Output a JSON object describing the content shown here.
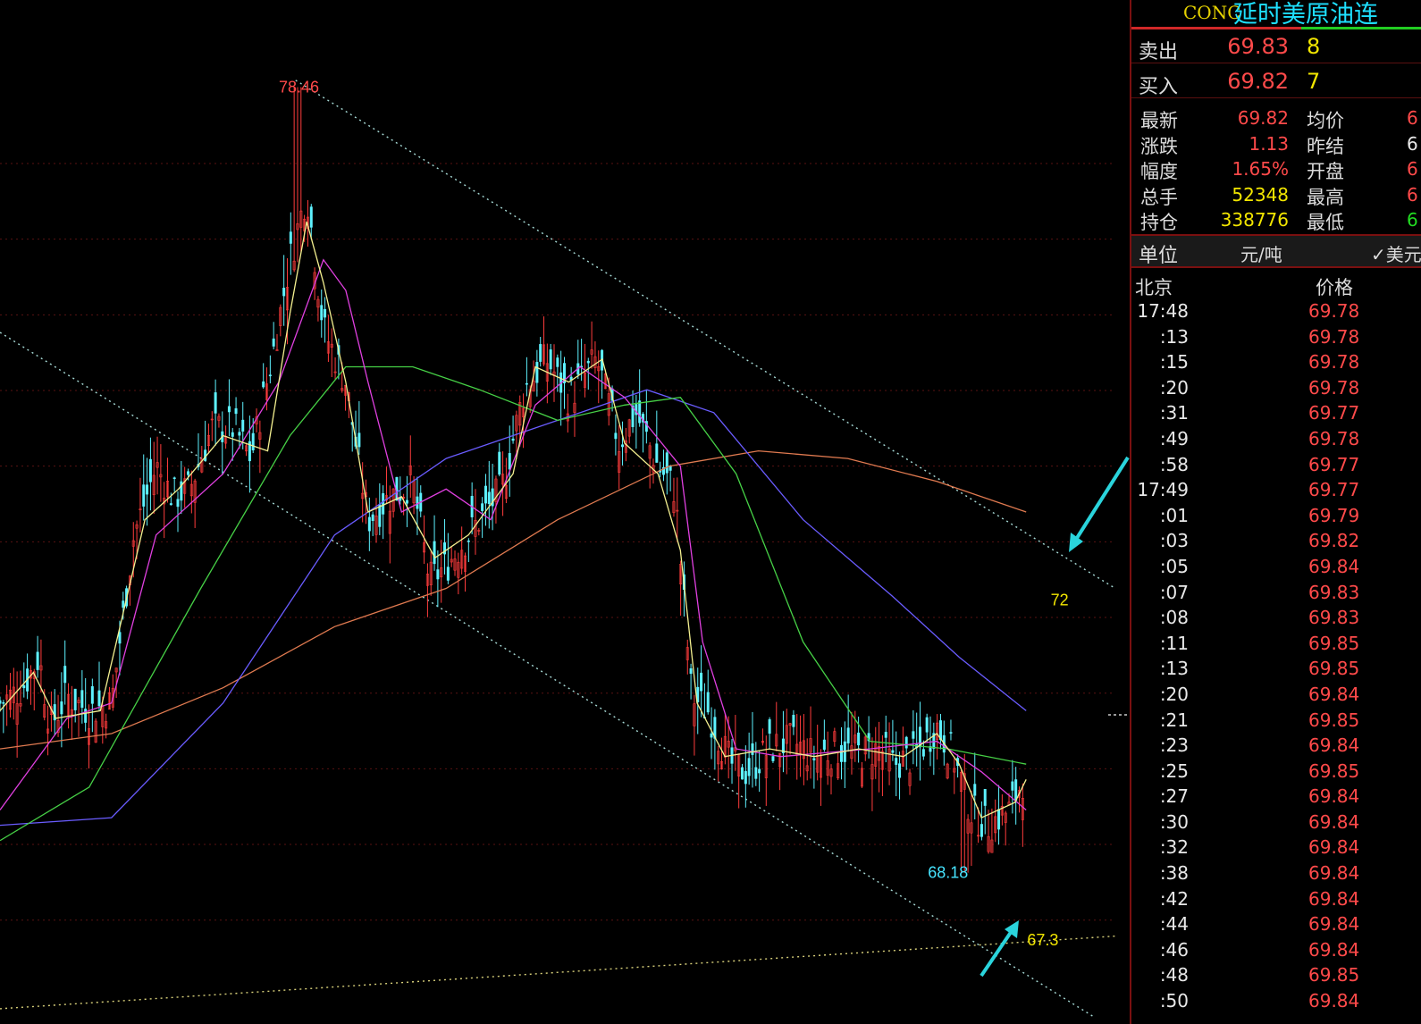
{
  "chart_data": {
    "type": "candlestick",
    "ylim": [
      66.2,
      79.6
    ],
    "gridlines": [
      77.46,
      76.47,
      75.48,
      74.49,
      73.5,
      72.51,
      71.52,
      70.53,
      69.54,
      68.55,
      67.56
    ],
    "annotations": [
      {
        "text": "78.46",
        "x": 0.268,
        "y": 78.46,
        "color": "#ff4a4a"
      },
      {
        "text": "68.18",
        "x": 0.85,
        "y": 68.18,
        "color": "#46e4ff"
      },
      {
        "text": "72",
        "x": 0.95,
        "y": 71.75,
        "color": "#f2e600"
      },
      {
        "text": "67.3",
        "x": 0.935,
        "y": 67.3,
        "color": "#f2e600"
      }
    ],
    "trend_lines": [
      {
        "from": [
          0.265,
          78.55
        ],
        "to": [
          1.0,
          71.9
        ]
      },
      {
        "from": [
          0.0,
          75.25
        ],
        "to": [
          0.98,
          66.3
        ]
      },
      {
        "from": [
          0.0,
          66.4
        ],
        "to": [
          1.0,
          67.35
        ]
      }
    ],
    "close_path": [
      [
        0.0,
        70.4
      ],
      [
        0.02,
        70.6
      ],
      [
        0.035,
        71.0
      ],
      [
        0.045,
        70.1
      ],
      [
        0.06,
        70.5
      ],
      [
        0.08,
        70.3
      ],
      [
        0.1,
        70.4
      ],
      [
        0.12,
        72.6
      ],
      [
        0.14,
        73.5
      ],
      [
        0.155,
        73.1
      ],
      [
        0.17,
        73.2
      ],
      [
        0.19,
        74.0
      ],
      [
        0.21,
        74.0
      ],
      [
        0.225,
        73.6
      ],
      [
        0.245,
        75.0
      ],
      [
        0.26,
        76.2
      ],
      [
        0.275,
        77.1
      ],
      [
        0.29,
        75.3
      ],
      [
        0.31,
        74.6
      ],
      [
        0.33,
        72.8
      ],
      [
        0.35,
        73.1
      ],
      [
        0.37,
        73.3
      ],
      [
        0.385,
        72.0
      ],
      [
        0.4,
        72.2
      ],
      [
        0.43,
        72.8
      ],
      [
        0.45,
        73.2
      ],
      [
        0.47,
        74.5
      ],
      [
        0.49,
        74.9
      ],
      [
        0.51,
        74.4
      ],
      [
        0.535,
        74.9
      ],
      [
        0.555,
        73.8
      ],
      [
        0.57,
        74.2
      ],
      [
        0.59,
        73.5
      ],
      [
        0.605,
        73.2
      ],
      [
        0.62,
        70.5
      ],
      [
        0.635,
        70.3
      ],
      [
        0.655,
        69.6
      ],
      [
        0.67,
        69.5
      ],
      [
        0.69,
        69.8
      ],
      [
        0.71,
        69.9
      ],
      [
        0.73,
        69.7
      ],
      [
        0.75,
        69.8
      ],
      [
        0.77,
        69.75
      ],
      [
        0.79,
        69.8
      ],
      [
        0.8,
        69.6
      ],
      [
        0.82,
        69.7
      ],
      [
        0.84,
        70.1
      ],
      [
        0.855,
        69.7
      ],
      [
        0.87,
        69.0
      ],
      [
        0.885,
        68.8
      ],
      [
        0.905,
        69.0
      ],
      [
        0.92,
        69.5
      ]
    ],
    "series": [
      {
        "key": "ma_orange",
        "color": "#e07a50",
        "points": [
          [
            0.0,
            69.8
          ],
          [
            0.1,
            70.0
          ],
          [
            0.2,
            70.6
          ],
          [
            0.3,
            71.4
          ],
          [
            0.4,
            71.9
          ],
          [
            0.5,
            72.8
          ],
          [
            0.6,
            73.5
          ],
          [
            0.68,
            73.7
          ],
          [
            0.76,
            73.6
          ],
          [
            0.84,
            73.3
          ],
          [
            0.92,
            72.9
          ]
        ]
      },
      {
        "key": "ma_blue",
        "color": "#6a5cff",
        "points": [
          [
            0.0,
            68.8
          ],
          [
            0.1,
            68.9
          ],
          [
            0.2,
            70.4
          ],
          [
            0.3,
            72.6
          ],
          [
            0.4,
            73.6
          ],
          [
            0.5,
            74.1
          ],
          [
            0.58,
            74.5
          ],
          [
            0.64,
            74.2
          ],
          [
            0.72,
            72.8
          ],
          [
            0.8,
            71.8
          ],
          [
            0.86,
            71.0
          ],
          [
            0.92,
            70.3
          ]
        ]
      },
      {
        "key": "ma_green",
        "color": "#46d046",
        "points": [
          [
            0.0,
            68.6
          ],
          [
            0.08,
            69.3
          ],
          [
            0.18,
            71.9
          ],
          [
            0.26,
            73.9
          ],
          [
            0.31,
            74.8
          ],
          [
            0.37,
            74.8
          ],
          [
            0.43,
            74.5
          ],
          [
            0.5,
            74.1
          ],
          [
            0.56,
            74.3
          ],
          [
            0.61,
            74.4
          ],
          [
            0.66,
            73.4
          ],
          [
            0.72,
            71.2
          ],
          [
            0.78,
            69.9
          ],
          [
            0.85,
            69.8
          ],
          [
            0.92,
            69.6
          ]
        ]
      },
      {
        "key": "ma_magenta",
        "color": "#e040e0",
        "points": [
          [
            0.0,
            69.0
          ],
          [
            0.06,
            70.2
          ],
          [
            0.1,
            70.4
          ],
          [
            0.14,
            72.6
          ],
          [
            0.2,
            73.4
          ],
          [
            0.25,
            74.6
          ],
          [
            0.29,
            76.2
          ],
          [
            0.31,
            75.8
          ],
          [
            0.33,
            74.6
          ],
          [
            0.36,
            72.9
          ],
          [
            0.4,
            73.2
          ],
          [
            0.44,
            72.8
          ],
          [
            0.48,
            74.3
          ],
          [
            0.52,
            74.8
          ],
          [
            0.56,
            74.4
          ],
          [
            0.61,
            73.5
          ],
          [
            0.63,
            71.2
          ],
          [
            0.66,
            69.8
          ],
          [
            0.7,
            69.7
          ],
          [
            0.78,
            69.8
          ],
          [
            0.84,
            69.9
          ],
          [
            0.88,
            69.5
          ],
          [
            0.92,
            69.0
          ]
        ]
      },
      {
        "key": "ma_yellow",
        "color": "#f4f090",
        "points": [
          [
            0.0,
            70.3
          ],
          [
            0.03,
            70.8
          ],
          [
            0.05,
            70.2
          ],
          [
            0.09,
            70.3
          ],
          [
            0.13,
            72.8
          ],
          [
            0.16,
            73.2
          ],
          [
            0.2,
            73.9
          ],
          [
            0.24,
            73.7
          ],
          [
            0.26,
            75.5
          ],
          [
            0.275,
            76.7
          ],
          [
            0.29,
            75.9
          ],
          [
            0.31,
            74.6
          ],
          [
            0.33,
            72.9
          ],
          [
            0.36,
            73.1
          ],
          [
            0.39,
            72.3
          ],
          [
            0.42,
            72.6
          ],
          [
            0.46,
            73.4
          ],
          [
            0.48,
            74.8
          ],
          [
            0.51,
            74.6
          ],
          [
            0.54,
            74.9
          ],
          [
            0.56,
            73.8
          ],
          [
            0.59,
            73.4
          ],
          [
            0.61,
            72.4
          ],
          [
            0.625,
            70.4
          ],
          [
            0.65,
            69.7
          ],
          [
            0.69,
            69.8
          ],
          [
            0.73,
            69.7
          ],
          [
            0.77,
            69.8
          ],
          [
            0.81,
            69.7
          ],
          [
            0.84,
            70.0
          ],
          [
            0.86,
            69.6
          ],
          [
            0.88,
            68.9
          ],
          [
            0.91,
            69.1
          ],
          [
            0.92,
            69.4
          ]
        ]
      }
    ]
  },
  "panel": {
    "code": "CONC",
    "name": "延时美原油连",
    "sell": {
      "label": "卖出",
      "price": "69.83",
      "qty": "8"
    },
    "buy": {
      "label": "买入",
      "price": "69.82",
      "qty": "7"
    },
    "stats": [
      {
        "l1": "最新",
        "v1": "69.82",
        "c1": "red",
        "l2": "均价",
        "v2": "6",
        "c2": "red"
      },
      {
        "l1": "涨跌",
        "v1": "1.13",
        "c1": "red",
        "l2": "昨结",
        "v2": "6",
        "c2": "wht"
      },
      {
        "l1": "幅度",
        "v1": "1.65%",
        "c1": "red",
        "l2": "开盘",
        "v2": "6",
        "c2": "red"
      },
      {
        "l1": "总手",
        "v1": "52348",
        "c1": "yel",
        "l2": "最高",
        "v2": "6",
        "c2": "red"
      },
      {
        "l1": "持仓",
        "v1": "338776",
        "c1": "yel",
        "l2": "最低",
        "v2": "6",
        "c2": "grn"
      }
    ],
    "unit": {
      "label": "单位",
      "value": "元/吨",
      "currency": "✓美元"
    },
    "ticks_header": {
      "time": "北京",
      "price": "价格"
    },
    "ticks": [
      {
        "time": "17:48",
        "price": "69.78"
      },
      {
        "time": ":13",
        "price": "69.78"
      },
      {
        "time": ":15",
        "price": "69.78"
      },
      {
        "time": ":20",
        "price": "69.78"
      },
      {
        "time": ":31",
        "price": "69.77"
      },
      {
        "time": ":49",
        "price": "69.78"
      },
      {
        "time": ":58",
        "price": "69.77"
      },
      {
        "time": "17:49",
        "price": "69.77"
      },
      {
        "time": ":01",
        "price": "69.79"
      },
      {
        "time": ":03",
        "price": "69.82"
      },
      {
        "time": ":05",
        "price": "69.84"
      },
      {
        "time": ":07",
        "price": "69.83"
      },
      {
        "time": ":08",
        "price": "69.83"
      },
      {
        "time": ":11",
        "price": "69.85"
      },
      {
        "time": ":13",
        "price": "69.85"
      },
      {
        "time": ":20",
        "price": "69.84"
      },
      {
        "time": ":21",
        "price": "69.85"
      },
      {
        "time": ":23",
        "price": "69.84"
      },
      {
        "time": ":25",
        "price": "69.85"
      },
      {
        "time": ":27",
        "price": "69.84"
      },
      {
        "time": ":30",
        "price": "69.84"
      },
      {
        "time": ":32",
        "price": "69.84"
      },
      {
        "time": ":38",
        "price": "69.84"
      },
      {
        "time": ":42",
        "price": "69.84"
      },
      {
        "time": ":44",
        "price": "69.84"
      },
      {
        "time": ":46",
        "price": "69.84"
      },
      {
        "time": ":48",
        "price": "69.85"
      },
      {
        "time": ":50",
        "price": "69.84"
      }
    ]
  }
}
